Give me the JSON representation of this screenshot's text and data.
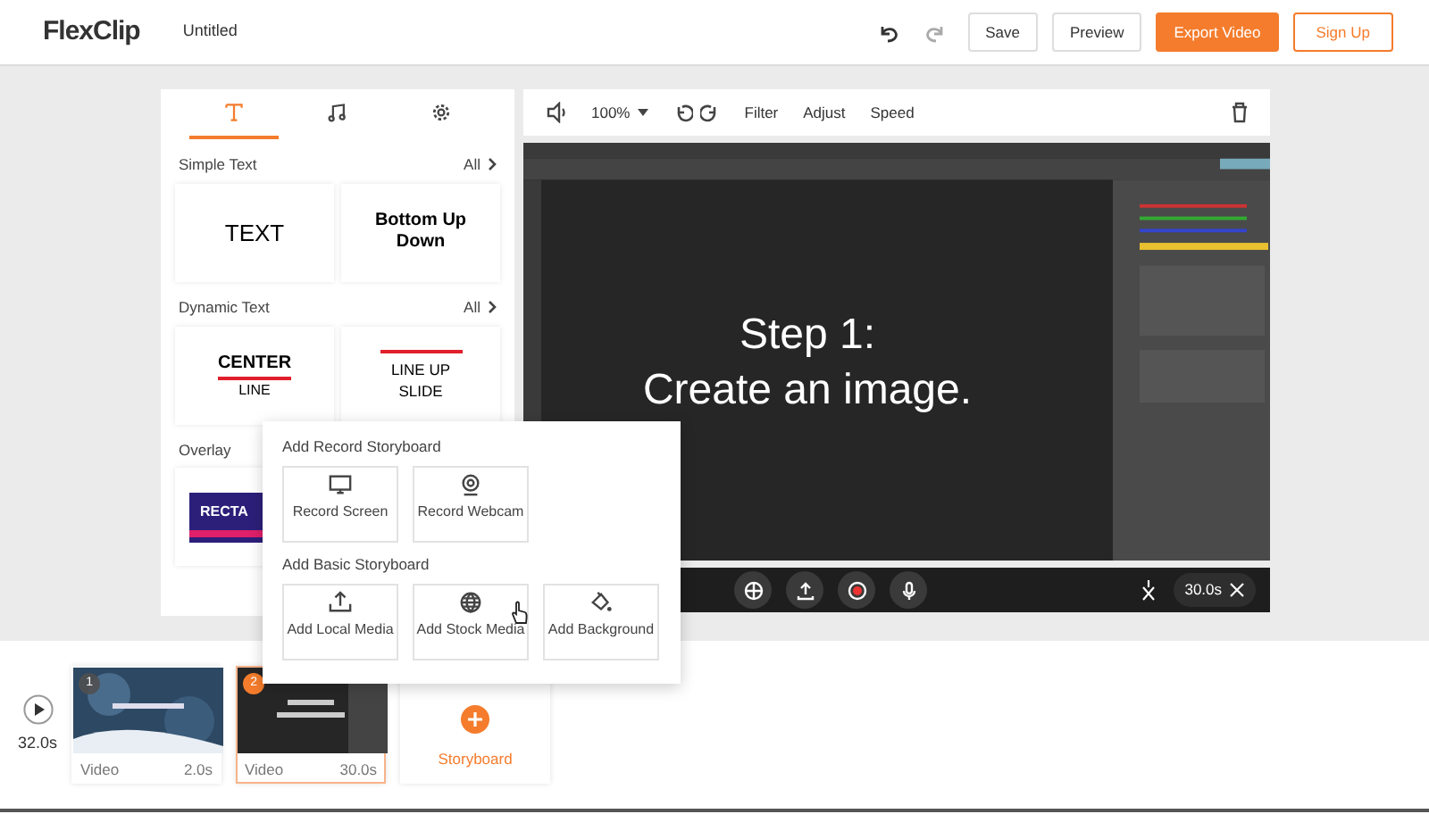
{
  "header": {
    "logo": "FlexClip",
    "project_title": "Untitled",
    "buttons": [
      {
        "label": "Save",
        "kind": "plain"
      },
      {
        "label": "Preview",
        "kind": "plain"
      },
      {
        "label": "Export Video",
        "kind": "primary"
      },
      {
        "label": "Sign Up",
        "kind": "outline"
      }
    ]
  },
  "side_tabs": [
    {
      "selected": true
    },
    {
      "selected": false
    },
    {
      "selected": false
    }
  ],
  "sections": [
    {
      "title": "Simple Text",
      "all_label": "All",
      "cards": [
        {
          "kind": "plain",
          "text": "TEXT"
        },
        {
          "kind": "bold",
          "text": "Bottom Up Down"
        }
      ]
    },
    {
      "title": "Dynamic Text",
      "all_label": "All",
      "cards": [
        {
          "kind": "underline",
          "text": "CENTER",
          "sub": "LINE"
        },
        {
          "kind": "overline",
          "text": "LINE UP SLIDE"
        }
      ]
    },
    {
      "title": "Overlay",
      "cards": [
        {
          "kind": "banner",
          "text": "RECTA"
        }
      ]
    }
  ],
  "toolbar": {
    "zoom": "100%",
    "items": [
      "Filter",
      "Adjust",
      "Speed"
    ]
  },
  "preview": {
    "caption_lines": [
      "Step 1:",
      "Create an image."
    ],
    "duration": "30.0s"
  },
  "popup": {
    "groups": [
      {
        "title": "Add Record Storyboard",
        "items": [
          {
            "label": "Record Screen"
          },
          {
            "label": "Record Webcam"
          }
        ]
      },
      {
        "title": "Add Basic Storyboard",
        "items": [
          {
            "label": "Add Local Media"
          },
          {
            "label": "Add Stock Media"
          },
          {
            "label": "Add Background"
          }
        ]
      }
    ]
  },
  "timeline": {
    "total": "32.0s",
    "clips": [
      {
        "number": "1",
        "type": "Video",
        "duration": "2.0s",
        "selected": false,
        "kind": "snow"
      },
      {
        "number": "2",
        "type": "Video",
        "duration": "30.0s",
        "selected": true,
        "kind": "dark"
      }
    ],
    "add_label": "Storyboard"
  }
}
